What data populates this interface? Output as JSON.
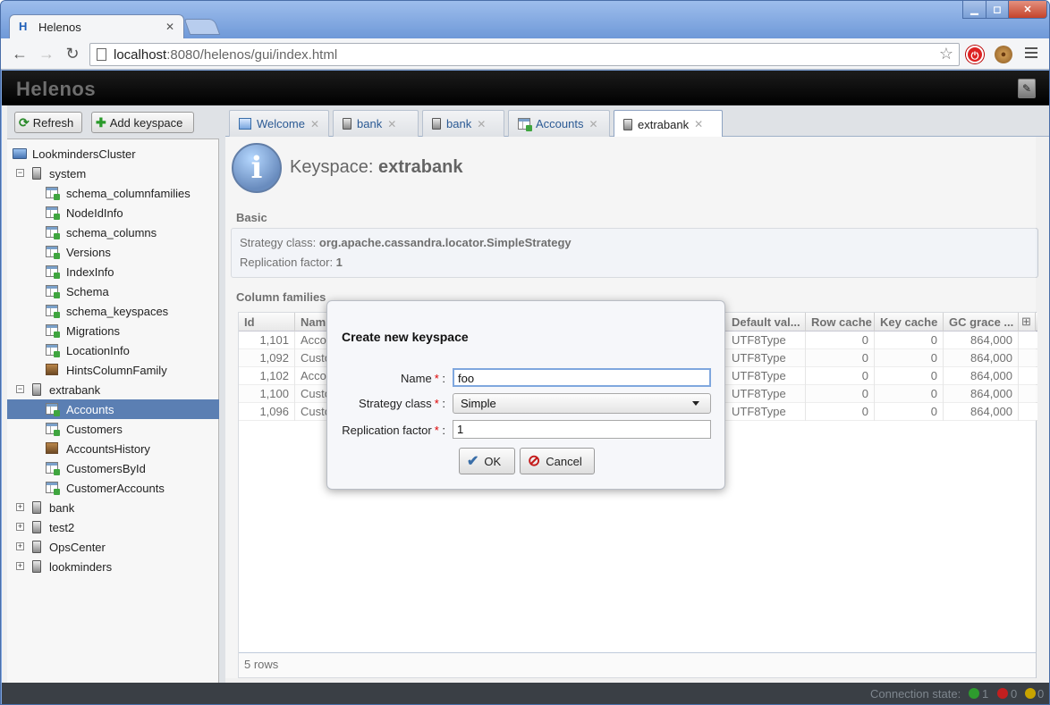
{
  "browser": {
    "tab_title": "Helenos",
    "tab_close": "✕",
    "url_host": "localhost",
    "url_path": ":8080/helenos/gui/index.html",
    "back_icon": "←",
    "forward_icon": "→",
    "reload_icon": "↻",
    "star_icon": "☆"
  },
  "app": {
    "logo": "Helenos",
    "refresh_label": "Refresh",
    "add_keyspace_label": "Add keyspace"
  },
  "tree": {
    "cluster": "LookmindersCluster",
    "nodes": [
      {
        "label": "system",
        "level": 1,
        "icon": "server",
        "expanded": "−"
      },
      {
        "label": "schema_columnfamilies",
        "level": 2,
        "icon": "table"
      },
      {
        "label": "NodeIdInfo",
        "level": 2,
        "icon": "table"
      },
      {
        "label": "schema_columns",
        "level": 2,
        "icon": "table"
      },
      {
        "label": "Versions",
        "level": 2,
        "icon": "table"
      },
      {
        "label": "IndexInfo",
        "level": 2,
        "icon": "table"
      },
      {
        "label": "Schema",
        "level": 2,
        "icon": "table"
      },
      {
        "label": "schema_keyspaces",
        "level": 2,
        "icon": "table"
      },
      {
        "label": "Migrations",
        "level": 2,
        "icon": "table"
      },
      {
        "label": "LocationInfo",
        "level": 2,
        "icon": "table"
      },
      {
        "label": "HintsColumnFamily",
        "level": 2,
        "icon": "hints"
      },
      {
        "label": "extrabank",
        "level": 1,
        "icon": "server",
        "expanded": "−"
      },
      {
        "label": "Accounts",
        "level": 2,
        "icon": "table",
        "selected": true
      },
      {
        "label": "Customers",
        "level": 2,
        "icon": "table"
      },
      {
        "label": "AccountsHistory",
        "level": 2,
        "icon": "hints"
      },
      {
        "label": "CustomersById",
        "level": 2,
        "icon": "table"
      },
      {
        "label": "CustomerAccounts",
        "level": 2,
        "icon": "table"
      },
      {
        "label": "bank",
        "level": 1,
        "icon": "server",
        "expanded": "+"
      },
      {
        "label": "test2",
        "level": 1,
        "icon": "server",
        "expanded": "+"
      },
      {
        "label": "OpsCenter",
        "level": 1,
        "icon": "server",
        "expanded": "+"
      },
      {
        "label": "lookminders",
        "level": 1,
        "icon": "server",
        "expanded": "+"
      }
    ]
  },
  "tabs": [
    {
      "label": "Welcome",
      "icon": "home"
    },
    {
      "label": "bank",
      "icon": "server"
    },
    {
      "label": "bank",
      "icon": "server"
    },
    {
      "label": "Accounts",
      "icon": "table"
    },
    {
      "label": "extrabank",
      "icon": "server",
      "active": true
    }
  ],
  "keyspace": {
    "title_prefix": "Keyspace: ",
    "title_name": "extrabank",
    "basic_heading": "Basic",
    "strategy_label": "Strategy class: ",
    "strategy_value": "org.apache.cassandra.locator.SimpleStrategy",
    "replication_label": "Replication factor: ",
    "replication_value": "1",
    "cf_heading": "Column families"
  },
  "grid": {
    "headers": [
      "Id",
      "Nam",
      "Default val...",
      "Row cache",
      "Key cache",
      "GC grace ..."
    ],
    "rows": [
      [
        "1,101",
        "Acco",
        "UTF8Type",
        "0",
        "0",
        "864,000"
      ],
      [
        "1,092",
        "Custo",
        "UTF8Type",
        "0",
        "0",
        "864,000"
      ],
      [
        "1,102",
        "Acco",
        "UTF8Type",
        "0",
        "0",
        "864,000"
      ],
      [
        "1,100",
        "Custo",
        "UTF8Type",
        "0",
        "0",
        "864,000"
      ],
      [
        "1,096",
        "Custo",
        "UTF8Type",
        "0",
        "0",
        "864,000"
      ]
    ],
    "footer": "5 rows"
  },
  "dialog": {
    "title": "Create new keyspace",
    "name_label": "Name",
    "name_value": "foo",
    "strategy_label": "Strategy class",
    "strategy_value": "Simple",
    "replication_label": "Replication factor",
    "replication_value": "1",
    "required_mark": "*",
    "colon": ":",
    "ok_label": "OK",
    "cancel_label": "Cancel"
  },
  "status": {
    "label": "Connection state:",
    "green_count": "1",
    "red_count": "0",
    "yellow_count": "0",
    "colors": {
      "green": "#2e9b2e",
      "red": "#c21f1f",
      "yellow": "#c9a400"
    }
  },
  "colors": {
    "accent": "#5b7fb3",
    "header_bg": "#000000",
    "tab_text": "#2b5a94"
  }
}
